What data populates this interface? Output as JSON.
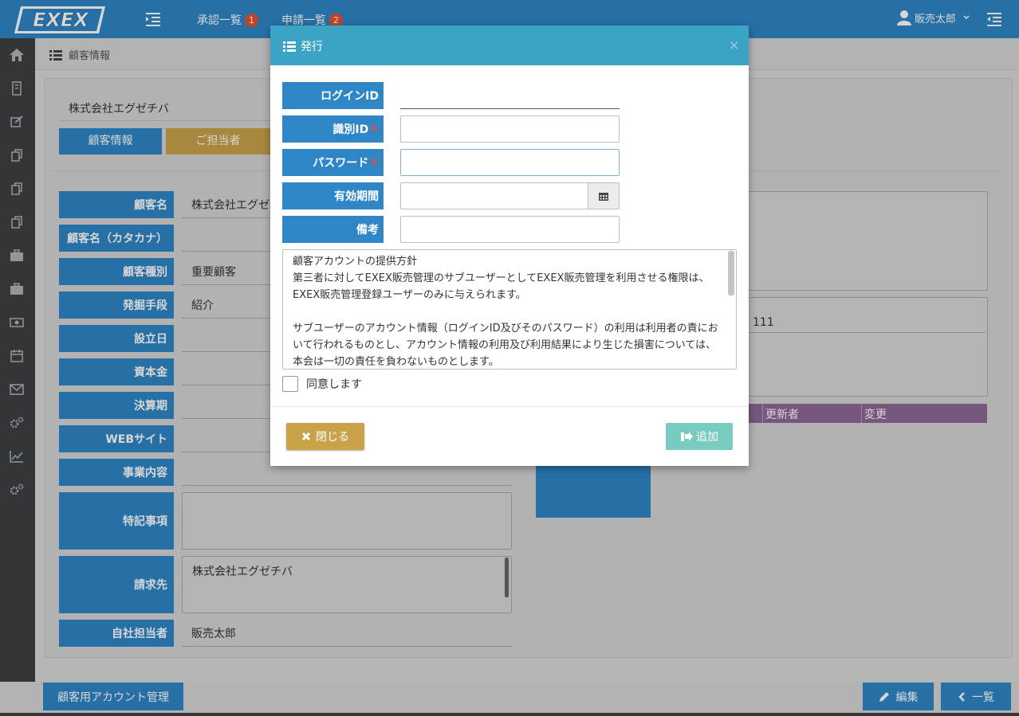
{
  "header": {
    "logo_text": "EXEX",
    "approvals_label": "承認一覧",
    "approvals_count": "1",
    "applications_label": "申請一覧",
    "applications_count": "2",
    "user_name": "販売太郎"
  },
  "sidebar": {
    "icons": [
      "home-icon",
      "building-icon",
      "edit-icon",
      "copy-icon",
      "copy-icon",
      "copy-icon",
      "briefcase-icon",
      "briefcase-icon",
      "money-icon",
      "calendar-icon",
      "mail-icon",
      "gears-icon",
      "chart-icon",
      "gears-icon"
    ]
  },
  "breadcrumb": {
    "label": "顧客情報"
  },
  "customer": {
    "title": "株式会社エグゼチバ",
    "tab_info": "顧客情報",
    "tab_contact": "ご担当者",
    "fields": [
      {
        "label": "顧客名",
        "value": "株式会社エグゼ"
      },
      {
        "label": "顧客名（カタカナ）",
        "value": ""
      },
      {
        "label": "顧客種別",
        "value": "重要顧客"
      },
      {
        "label": "発掘手段",
        "value": "紹介"
      },
      {
        "label": "設立日",
        "value": ""
      },
      {
        "label": "資本金",
        "value": ""
      },
      {
        "label": "決算期",
        "value": ""
      },
      {
        "label": "WEBサイト",
        "value": ""
      },
      {
        "label": "事業内容",
        "value": ""
      },
      {
        "label": "特記事項",
        "value": ""
      },
      {
        "label": "請求先",
        "value": "株式会社エグゼチバ"
      },
      {
        "label": "自社担当者",
        "value": "販売太郎"
      }
    ],
    "right_partial_value": "111",
    "history_headers": [
      "更新者",
      "変更"
    ]
  },
  "footer": {
    "account_mgmt": "顧客用アカウント管理",
    "edit": "編集",
    "list": "一覧"
  },
  "modal": {
    "title": "発行",
    "close_x": "×",
    "login_id_label": "ログインID",
    "login_id_value": "",
    "ident_id_label": "識別ID",
    "password_label": "パスワード",
    "validity_label": "有効期間",
    "memo_label": "備考",
    "required_mark": "※",
    "terms": {
      "heading": "顧客アカウントの提供方針",
      "p1": "第三者に対してEXEX販売管理のサブユーザーとしてEXEX販売管理を利用させる権限は、EXEX販売管理登録ユーザーのみに与えられます。",
      "p2": "サブユーザーのアカウント情報（ログインID及びそのパスワード）の利用は利用者の責において行われるものとし、アカウント情報の利用及び利用結果により生じた損害については、本会は一切の責任を負わないものとします。"
    },
    "agree_label": "同意します",
    "close_button": "閉じる",
    "add_button": "追加"
  }
}
